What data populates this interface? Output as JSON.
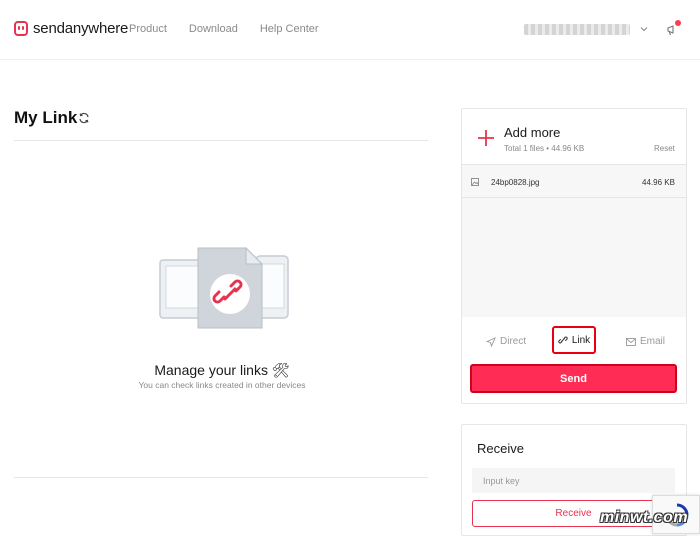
{
  "brand": {
    "name": "sendanywhere",
    "accent": "#ff2d55"
  },
  "nav": [
    {
      "label": "Product"
    },
    {
      "label": "Download"
    },
    {
      "label": "Help Center"
    }
  ],
  "main": {
    "title": "My Link",
    "empty_title": "Manage your links 🛠",
    "empty_subtitle": "You can check links created in other devices"
  },
  "send": {
    "add_more": "Add more",
    "summary": "Total 1 files • 44.96 KB",
    "reset": "Reset",
    "files": [
      {
        "name": "24bp0828.jpg",
        "size": "44.96 KB"
      }
    ],
    "modes": [
      {
        "label": "Direct",
        "icon": "send-icon"
      },
      {
        "label": "Link",
        "icon": "link-icon",
        "selected": true
      },
      {
        "label": "Email",
        "icon": "mail-icon"
      }
    ],
    "send_label": "Send"
  },
  "receive": {
    "title": "Receive",
    "key_placeholder": "Input key",
    "button_label": "Receive"
  },
  "watermark": "minwt.com"
}
